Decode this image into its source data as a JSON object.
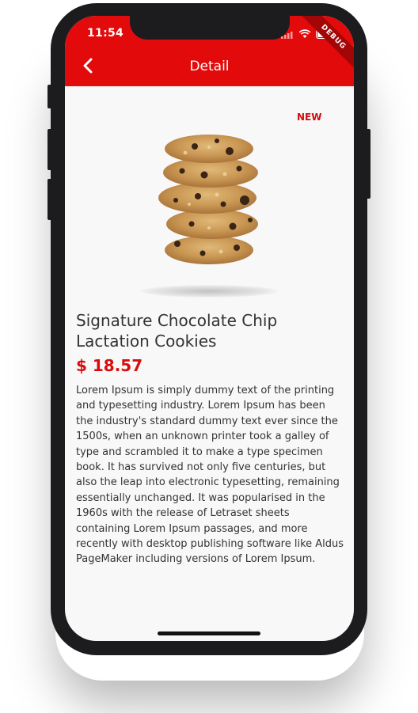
{
  "status_bar": {
    "time": "11:54",
    "debug_label": "DEBUG"
  },
  "header": {
    "title": "Detail",
    "back_icon": "chevron-left-icon"
  },
  "product": {
    "badge": "NEW",
    "name": "Signature Chocolate Chip Lactation Cookies",
    "price": "$ 18.57",
    "description": "Lorem Ipsum is simply dummy text of the printing and typesetting industry. Lorem Ipsum has been the industry's standard dummy text ever since the 1500s, when an unknown printer took a galley of type and scrambled it to make a type specimen book. It has survived not only five centuries, but also the leap into electronic typesetting, remaining essentially unchanged. It was popularised in the 1960s with the release of Letraset sheets containing Lorem Ipsum passages, and more recently with desktop publishing software like Aldus PageMaker including versions of Lorem Ipsum."
  },
  "colors": {
    "primary": "#e20a0a",
    "price": "#d80d0d",
    "text": "#333333",
    "background": "#f8f8f8"
  }
}
